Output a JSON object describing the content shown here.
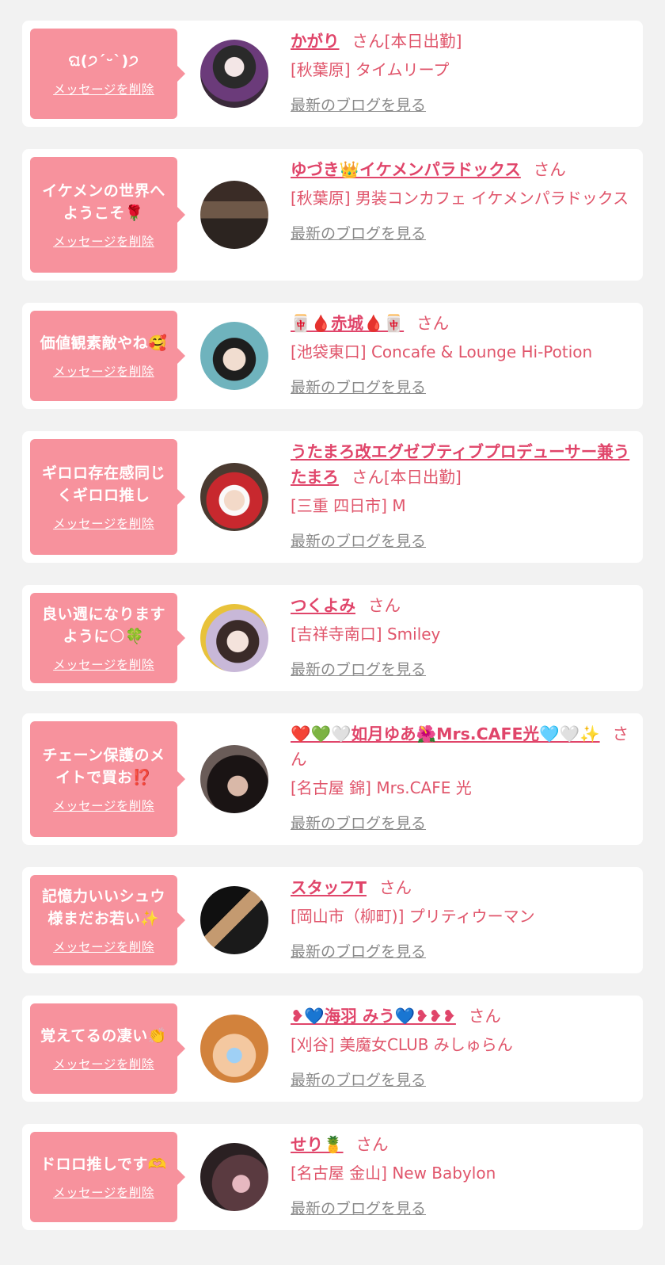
{
  "delete_label": "メッセージを削除",
  "blog_label": "最新のブログを見る",
  "colors": {
    "background": "#f2f2f2",
    "card": "#ffffff",
    "bubble": "#f7929d",
    "accent": "#e0456a",
    "link_gray": "#888888"
  },
  "entries": [
    {
      "message": "ଘ(੭ˊᵕˋ)੭",
      "name": "かがり",
      "suffix": "さん[本日出勤]",
      "place": "[秋葉原] タイムリープ"
    },
    {
      "message": "イケメンの世界へ\nようこそ🌹",
      "name": "ゆづき👑イケメンパラドックス",
      "suffix": "さん",
      "place": "[秋葉原] 男装コンカフェ イケメンパラドックス"
    },
    {
      "message": "価値観素敵やね🥰",
      "name": "🀄🩸赤城🩸🀄",
      "suffix": "さん",
      "place": "[池袋東口] Concafe & Lounge Hi-Potion"
    },
    {
      "message": "ギロロ存在感同じ\nくギロロ推し",
      "name": "うたまろ改エグゼブティブプロデューサー兼うたまろ",
      "suffix": "さん[本日出勤]",
      "place": "[三重 四日市] M"
    },
    {
      "message": "良い週になります\nように🌕🍀",
      "name": "つくよみ",
      "suffix": "さん",
      "place": "[吉祥寺南口] Smiley"
    },
    {
      "message": "チェーン保護のメ\nイトで買お⁉️",
      "name": "❤️💚🤍如月ゆあ🌺Mrs.CAFE光🩵🤍✨",
      "suffix": "さん",
      "place": "[名古屋 錦] Mrs.CAFE 光"
    },
    {
      "message": "記憶力いいシュウ\n様まだお若い✨",
      "name": "スタッフT",
      "suffix": "さん",
      "place": "[岡山市（柳町)] プリティウーマン"
    },
    {
      "message": "覚えてるの凄い👏",
      "name": "❥💙海羽 みう💙❥❥❥",
      "suffix": "さん",
      "place": "[刈谷] 美魔女CLUB みしゅらん"
    },
    {
      "message": "ドロロ推しです🫶",
      "name": "せり🍍",
      "suffix": "さん",
      "place": "[名古屋 金山] New Babylon"
    }
  ]
}
